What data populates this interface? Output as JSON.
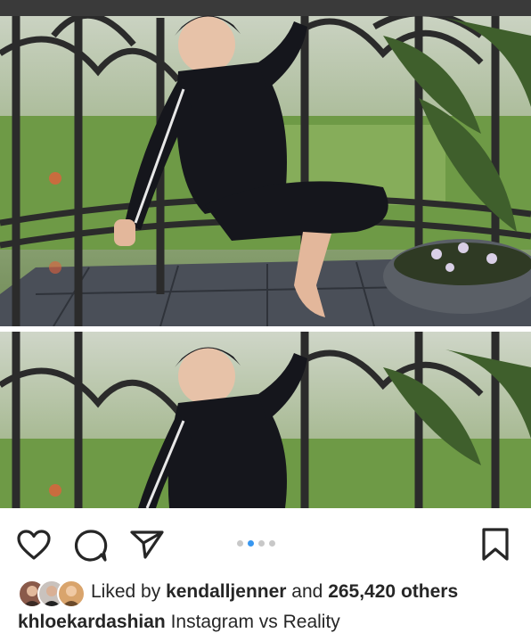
{
  "post": {
    "carousel": {
      "total_slides": 4,
      "active_slide": 2
    },
    "likes": {
      "prefix": "Liked by",
      "user": "kendalljenner",
      "joiner": "and",
      "count": "265,420",
      "suffix": "others"
    },
    "caption": {
      "username": "khloekardashian",
      "text": "Instagram vs Reality"
    }
  },
  "icons": {
    "like": "heart-icon",
    "comment": "comment-bubble-icon",
    "share": "paper-plane-icon",
    "save": "bookmark-icon"
  },
  "colors": {
    "text": "#262626",
    "active_dot": "#3897f0",
    "inactive_dot": "#c8c8c8"
  }
}
